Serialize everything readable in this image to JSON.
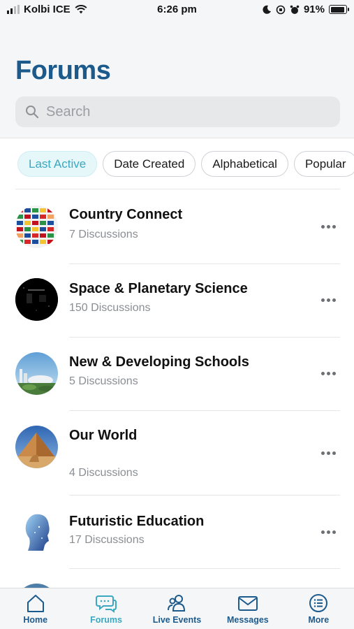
{
  "status_bar": {
    "carrier": "Kolbi ICE",
    "time": "6:26 pm",
    "battery": "91%"
  },
  "page": {
    "title": "Forums"
  },
  "search": {
    "placeholder": "Search"
  },
  "filters": [
    {
      "label": "Last Active",
      "active": true
    },
    {
      "label": "Date Created",
      "active": false
    },
    {
      "label": "Alphabetical",
      "active": false
    },
    {
      "label": "Popular",
      "active": false
    }
  ],
  "forums": [
    {
      "name": "Country Connect",
      "discussions": "7 Discussions",
      "avatar_icon": "world-flags-icon"
    },
    {
      "name": "Space & Planetary Science",
      "discussions": "150 Discussions",
      "avatar_icon": "night-sky-icon"
    },
    {
      "name": "New & Developing Schools",
      "discussions": "5 Discussions",
      "avatar_icon": "futuristic-city-icon"
    },
    {
      "name": "Our World",
      "discussions": "4 Discussions",
      "avatar_icon": "pyramid-sphinx-icon"
    },
    {
      "name": "Futuristic Education",
      "discussions": "17 Discussions",
      "avatar_icon": "digital-head-icon"
    }
  ],
  "tabs": [
    {
      "label": "Home",
      "icon": "home-icon",
      "active": false
    },
    {
      "label": "Forums",
      "icon": "forums-icon",
      "active": true
    },
    {
      "label": "Live Events",
      "icon": "people-icon",
      "active": false
    },
    {
      "label": "Messages",
      "icon": "envelope-icon",
      "active": false
    },
    {
      "label": "More",
      "icon": "menu-icon",
      "active": false
    }
  ],
  "colors": {
    "title": "#1d5a8c",
    "accent": "#3aa8c0",
    "active_chip_bg": "#e6f7fa"
  }
}
